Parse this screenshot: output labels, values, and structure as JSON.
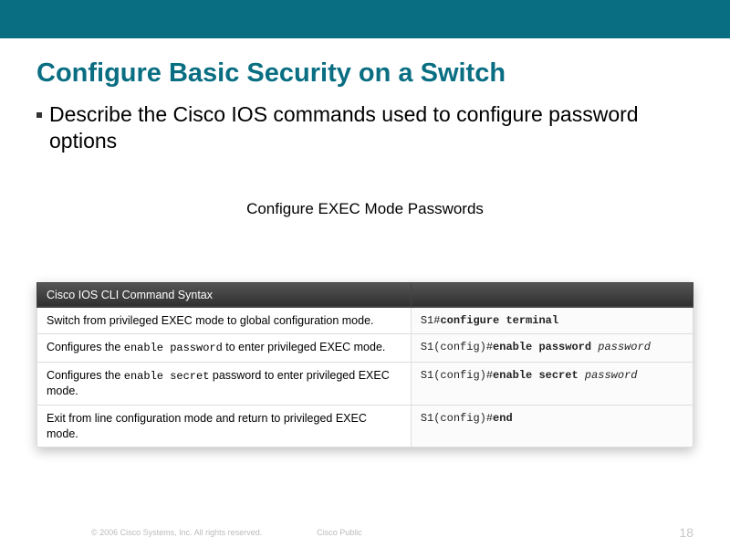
{
  "header": {
    "title": "Configure Basic Security on a Switch",
    "bullet": "Describe the Cisco IOS commands used to configure password options"
  },
  "subheading": "Configure EXEC Mode Passwords",
  "table": {
    "header_left": "Cisco IOS CLI Command Syntax",
    "header_right": "",
    "rows": [
      {
        "desc_pre": "Switch from privileged EXEC mode to global configuration mode.",
        "desc_mono": "",
        "desc_post": "",
        "prompt": "S1#",
        "cmd": "configure terminal",
        "arg": ""
      },
      {
        "desc_pre": "Configures the ",
        "desc_mono": "enable password",
        "desc_post": " to enter privileged EXEC mode.",
        "prompt": "S1(config)#",
        "cmd": "enable password",
        "arg": "password"
      },
      {
        "desc_pre": "Configures the ",
        "desc_mono": "enable secret",
        "desc_post": " password to enter privileged EXEC mode.",
        "prompt": "S1(config)#",
        "cmd": "enable secret",
        "arg": "password"
      },
      {
        "desc_pre": "Exit from line configuration mode and return to privileged EXEC mode.",
        "desc_mono": "",
        "desc_post": "",
        "prompt": "S1(config)#",
        "cmd": "end",
        "arg": ""
      }
    ]
  },
  "footer": {
    "copyright": "© 2006 Cisco Systems, Inc. All rights reserved.",
    "label": "Cisco Public",
    "page": "18"
  }
}
